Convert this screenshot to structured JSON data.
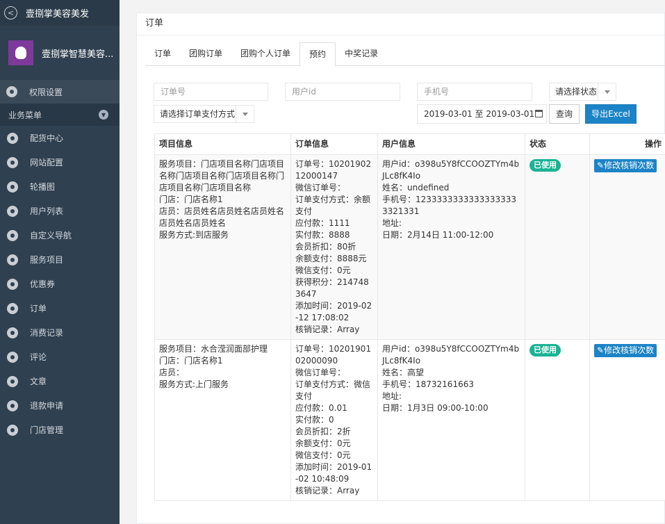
{
  "sidebar": {
    "app_title": "壹捌掌美容美发",
    "brand_name": "壹捌掌智慧美容...",
    "perm_item": "权限设置",
    "section_label": "业务菜单",
    "items": [
      "配货中心",
      "网站配置",
      "轮播图",
      "用户列表",
      "自定义导航",
      "服务项目",
      "优惠券",
      "订单",
      "消费记录",
      "评论",
      "文章",
      "退款申请",
      "门店管理"
    ]
  },
  "panel": {
    "title": "订单"
  },
  "tabs": [
    "订单",
    "团购订单",
    "团购个人订单",
    "预约",
    "中奖记录"
  ],
  "filters": {
    "order_no_placeholder": "订单号",
    "user_id_placeholder": "用户id",
    "phone_placeholder": "手机号",
    "status_select": "请选择状态",
    "pay_method_select": "请选择订单支付方式",
    "date_range": "2019-03-01 至 2019-03-01",
    "query_button": "查询",
    "export_button": "导出Excel"
  },
  "table": {
    "headers": [
      "项目信息",
      "订单信息",
      "用户信息",
      "状态",
      "操作"
    ],
    "rows": [
      {
        "project": [
          "服务项目：门店项目名称门店项目名称门店项目名称门店项目名称门店项目名称门店项目名称",
          "门店：门店名称1",
          "店员：店员姓名店员姓名店员姓名店员姓名店员姓名",
          "服务方式:到店服务"
        ],
        "order": [
          "订单号：1020190212000147",
          "微信订单号：",
          "订单支付方式：余额支付",
          "应付款：1111",
          "实付款：8888",
          "会员折扣：80折",
          "余额支付：8888元",
          "微信支付：0元",
          "获得积分：2147483647",
          "添加时间：2019-02-12 17:08:02",
          "核销记录：Array"
        ],
        "user": [
          "用户id：o398u5Y8fCCOOZTYm4bJLc8fK4Io",
          "姓名：undefined",
          "手机号：12333333333333333333321331",
          "地址:",
          "日期：2月14日 11:00-12:00"
        ],
        "status": "已使用",
        "action": "修改核销次数"
      },
      {
        "project": [
          "服务项目：水合滢润面部护理",
          "门店：门店名称1",
          "店员：",
          "服务方式:上门服务"
        ],
        "order": [
          "订单号：1020190102000090",
          "微信订单号：",
          "订单支付方式：微信支付",
          "应付款：0.01",
          "实付款：0",
          "会员折扣：2折",
          "余额支付：0元",
          "微信支付：0元",
          "添加时间：2019-01-02 10:48:09",
          "核销记录：Array"
        ],
        "user": [
          "用户id：o398u5Y8fCCOOZTYm4bJLc8fK4Io",
          "姓名：高望",
          "手机号：18732161663",
          "地址:",
          "日期：1月3日 09:00-10:00"
        ],
        "status": "已使用",
        "action": "修改核销次数"
      }
    ]
  }
}
